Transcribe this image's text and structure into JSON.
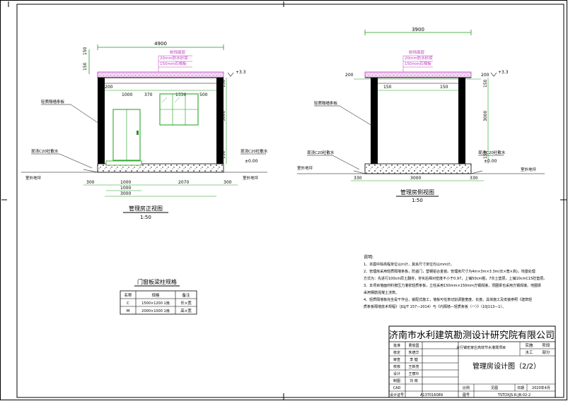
{
  "front_view": {
    "title": "管理房正视图",
    "scale": "1:50",
    "overall_dim": "4900",
    "top_dims": [
      "200",
      "1000",
      "370",
      "1330",
      "500"
    ],
    "bottom_dims": [
      "300",
      "1000",
      "2070",
      "300"
    ],
    "bottom_dims2": [
      "1000"
    ],
    "bottom_dims3": [
      "3000"
    ],
    "left_dims": [
      "150",
      "150"
    ],
    "right_dims": [
      "150",
      "3000",
      "150"
    ],
    "roof_notes": [
      "粉饰面层",
      "20mm防水砂浆",
      "150mm石棉板"
    ],
    "elevation_top": "+3.3",
    "elevation_floor": "±0.00",
    "label_wall": "轻质隔墙条板",
    "label_left_floor": "现浇C20砼散水",
    "label_right_floor": "现浇C20砼散水",
    "label_ground_left": "室外地坪",
    "label_ground_right": "室外地坪"
  },
  "side_view": {
    "title": "管理房侧视图",
    "scale": "1:50",
    "overall_dim": "3900",
    "top_dims": [
      "200",
      "150",
      "150",
      "200"
    ],
    "bottom_dims": [
      "330",
      "3000",
      "330"
    ],
    "right_dims": [
      "150",
      "3000",
      "150"
    ],
    "roof_notes": [
      "粉饰面层",
      "20mm防水砂浆",
      "150mm石棉板"
    ],
    "elevation_top": "+3.3",
    "elevation_floor": "±0.00",
    "label_wall": "轻质隔墙条板",
    "label_left_floor": "现浇C20砼散水",
    "label_right_floor": "现浇C20砼散水",
    "label_ground_left": "室外地坪",
    "label_ground_right": "室外地坪"
  },
  "schedule": {
    "title": "门窗板梁柱规格",
    "headers": [
      "名称",
      "规格",
      "备注"
    ],
    "rows": [
      [
        "C",
        "1500×1200   1扇",
        "长×宽"
      ],
      [
        "M",
        "2000×1000   1扇",
        "高×宽"
      ]
    ]
  },
  "notes": {
    "heading": "说明:",
    "lines": [
      "1、本图中除高程单位以m计，其余尺寸单位均以mm计。",
      "2、管理房采用轻质隔墙条板，防盗门，塑钢铝合金窗。管理房尺寸为4m×3m×3.3m(长×宽×高)，地基处理",
      "方式为：先进行100cm原土翻夯，夯实后相对密度不小于0.97，上铺50cm粗，7灰土垫层，上铺10cmC15砼垫层。",
      "3、本项目墙面材料按压力灌浆轻质条板，立柱采用150mm×150mm方钢焊接，顶圈梁也采用方钢焊接。地圈梁",
      "采用钢筋混凝土浇筑。",
      "4、轻质隔墙板完全是干作业，装配式施工，墙板可任意切割调整宽度、长度。具体施工及安装参照《建筑轻",
      "质条板隔墙技术规程》（JGJ/T 157—2014）与《内隔墙—轻质条板（一）》（10J113—1）。"
    ]
  },
  "title_block": {
    "institute": "济南市水利建筑勘测设计研究院有限公司",
    "project": "太行镇宏家庄高效节水灌溉项目",
    "drawing_title": "管理房设计图（2/2）",
    "stage_label": "实施",
    "stage_value": "阶段",
    "dept_label": "水工",
    "dept_value": "部分",
    "roles": [
      "批准",
      "核定",
      "审查",
      "校核",
      "设计",
      "制图",
      "CAD",
      "设计证号"
    ],
    "signatures": [
      "曹俊国",
      "朱德华",
      "李 健",
      "王新亮",
      "王丽玲",
      "刘 晓",
      "",
      ""
    ],
    "cert_no": "A137016089",
    "scale_label": "比例",
    "scale_value": "见图",
    "date_label": "日期",
    "date_value": "2020年4月",
    "no_label": "图号",
    "no_value": "TSTDXJS-R-JB-02-2"
  }
}
